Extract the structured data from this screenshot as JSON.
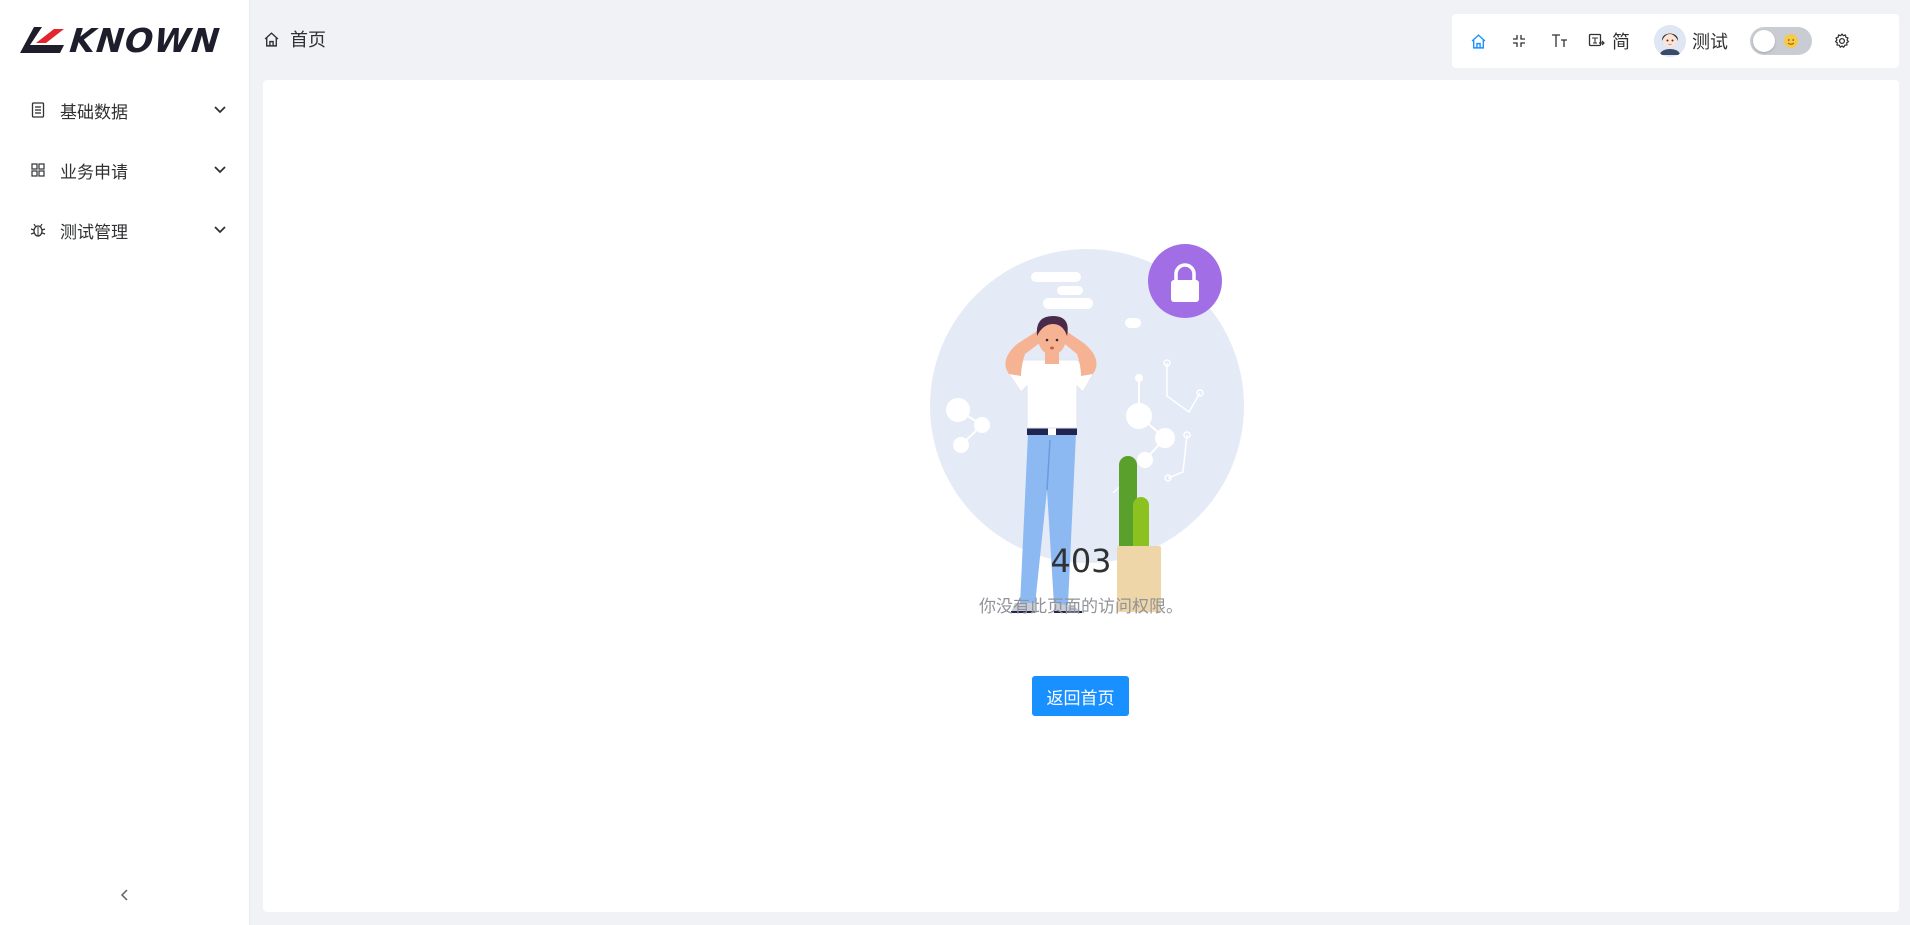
{
  "app": {
    "logo_text": "KNOWN",
    "brand_color": "#e3262d",
    "accent_color": "#1890ff"
  },
  "sidebar": {
    "items": [
      {
        "label": "基础数据",
        "icon": "document-icon"
      },
      {
        "label": "业务申请",
        "icon": "grid-icon"
      },
      {
        "label": "测试管理",
        "icon": "bug-icon"
      }
    ],
    "collapse_icon": "chevron-left-icon"
  },
  "header": {
    "breadcrumb": {
      "label": "首页",
      "icon": "home-icon"
    },
    "toolbar": {
      "home_icon": "home-icon",
      "fullscreen_icon": "fullscreen-icon",
      "font_size_icon": "font-size-icon",
      "language_label": "简",
      "user_name": "测试",
      "settings_icon": "gear-icon"
    }
  },
  "main": {
    "error_code": "403",
    "message": "你没有此页面的访问权限。",
    "back_button": "返回首页"
  }
}
